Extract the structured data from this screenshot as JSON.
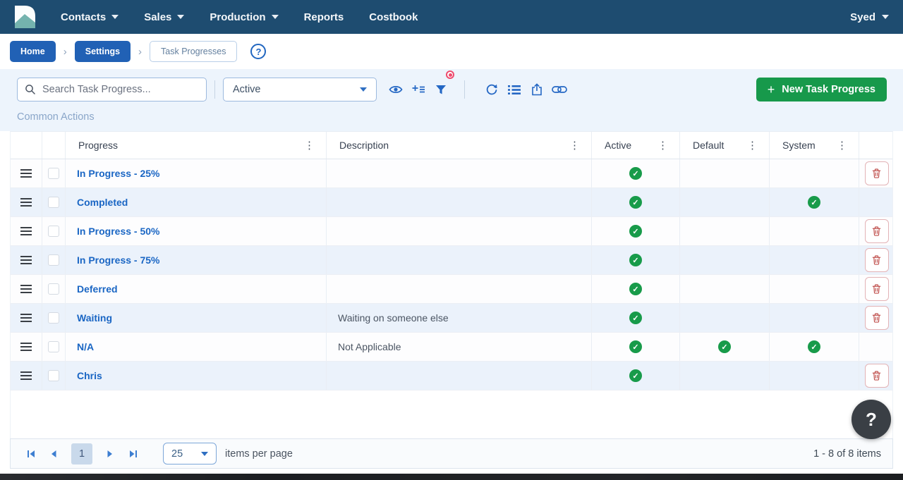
{
  "nav": {
    "items": [
      {
        "label": "Contacts",
        "has_dropdown": true
      },
      {
        "label": "Sales",
        "has_dropdown": true
      },
      {
        "label": "Production",
        "has_dropdown": true
      },
      {
        "label": "Reports",
        "has_dropdown": false
      },
      {
        "label": "Costbook",
        "has_dropdown": false
      }
    ],
    "user": "Syed"
  },
  "breadcrumb": {
    "home": "Home",
    "settings": "Settings",
    "current": "Task Progresses"
  },
  "toolbar": {
    "search_placeholder": "Search Task Progress...",
    "filter_dropdown_value": "Active",
    "icons": [
      "eye-icon",
      "add-column-icon",
      "filter-icon",
      "refresh-icon",
      "list-view-icon",
      "export-icon",
      "link-icon"
    ],
    "filter_badge": "active-filter-indicator",
    "new_button_label": "New Task Progress",
    "new_button_plus": "+",
    "common_actions_label": "Common Actions"
  },
  "table": {
    "columns": {
      "progress": "Progress",
      "description": "Description",
      "active": "Active",
      "default": "Default",
      "system": "System"
    },
    "rows": [
      {
        "progress": "In Progress - 25%",
        "description": "",
        "active": true,
        "default": false,
        "system": false,
        "deletable": true
      },
      {
        "progress": "Completed",
        "description": "",
        "active": true,
        "default": false,
        "system": true,
        "deletable": false
      },
      {
        "progress": "In Progress - 50%",
        "description": "",
        "active": true,
        "default": false,
        "system": false,
        "deletable": true
      },
      {
        "progress": "In Progress - 75%",
        "description": "",
        "active": true,
        "default": false,
        "system": false,
        "deletable": true
      },
      {
        "progress": "Deferred",
        "description": "",
        "active": true,
        "default": false,
        "system": false,
        "deletable": true
      },
      {
        "progress": "Waiting",
        "description": "Waiting on someone else",
        "active": true,
        "default": false,
        "system": false,
        "deletable": true
      },
      {
        "progress": "N/A",
        "description": "Not Applicable",
        "active": true,
        "default": true,
        "system": true,
        "deletable": false
      },
      {
        "progress": "Chris",
        "description": "",
        "active": true,
        "default": false,
        "system": false,
        "deletable": true
      }
    ]
  },
  "pagination": {
    "current_page": "1",
    "page_size": "25",
    "items_per_page_label": "items per page",
    "range_label": "1 - 8 of 8 items"
  },
  "help": {
    "crumb_help": "?",
    "fab_label": "?"
  },
  "colors": {
    "nav_bg": "#1e4c70",
    "accent_blue": "#2161b5",
    "icon_blue": "#2467c4",
    "link_blue": "#1a66c4",
    "button_green": "#17994b",
    "check_green": "#189b4a",
    "delete_red": "#c0504d",
    "badge_red": "#ee4b6e",
    "panel_bg": "#edf4fc",
    "alt_row_bg": "#ebf2fb"
  }
}
